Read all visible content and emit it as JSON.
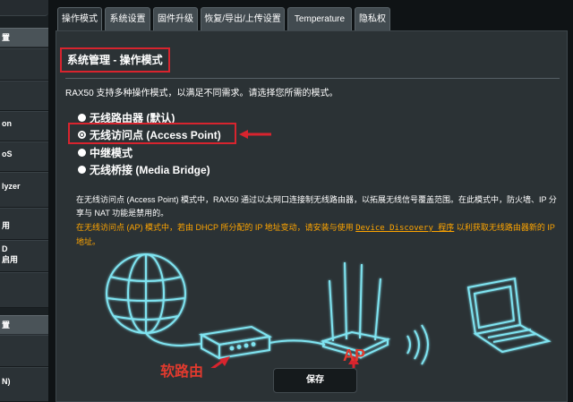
{
  "sidebar": {
    "header1": "置",
    "items": [
      {
        "label": "on"
      },
      {
        "label": "oS"
      },
      {
        "label": "lyzer"
      },
      {
        "label": "用"
      },
      {
        "label": "D"
      },
      {
        "label": "启用"
      }
    ],
    "header2": "置",
    "bottom_item": "N)"
  },
  "tabs": [
    {
      "label": "操作模式"
    },
    {
      "label": "系统设置"
    },
    {
      "label": "固件升级"
    },
    {
      "label": "恢复/导出/上传设置"
    },
    {
      "label": "Temperature"
    },
    {
      "label": "隐私权"
    }
  ],
  "page": {
    "title": "系统管理 - 操作模式",
    "description": "RAX50 支持多种操作模式，以满足不同需求。请选择您所需的模式。"
  },
  "modes": [
    {
      "label": "无线路由器 (默认)",
      "selected": false
    },
    {
      "label": "无线访问点 (Access Point)",
      "selected": true
    },
    {
      "label": "中继模式",
      "selected": false
    },
    {
      "label": "无线桥接 (Media Bridge)",
      "selected": false
    }
  ],
  "notes": {
    "white": "在无线访问点 (Access Point) 模式中，RAX50 通过以太网口连接制无线路由器，以拓展无线信号覆盖范围。在此模式中，防火墙、IP 分享与 NAT 功能是禁用的。",
    "orange_before": "在无线访问点 (AP) 模式中，若由 DHCP 所分配的 IP 地址变动，请安装与使用 ",
    "orange_link": "Device Discovery 程序",
    "orange_after": " 以利获取无线路由器新的 IP 地址。"
  },
  "illustration": {
    "soft_router_label": "软路由",
    "ap_label": "AP"
  },
  "save_label": "保存",
  "colors": {
    "highlight": "#d8242e",
    "note_orange": "#ffa500",
    "glow": "#7fe3f0"
  }
}
